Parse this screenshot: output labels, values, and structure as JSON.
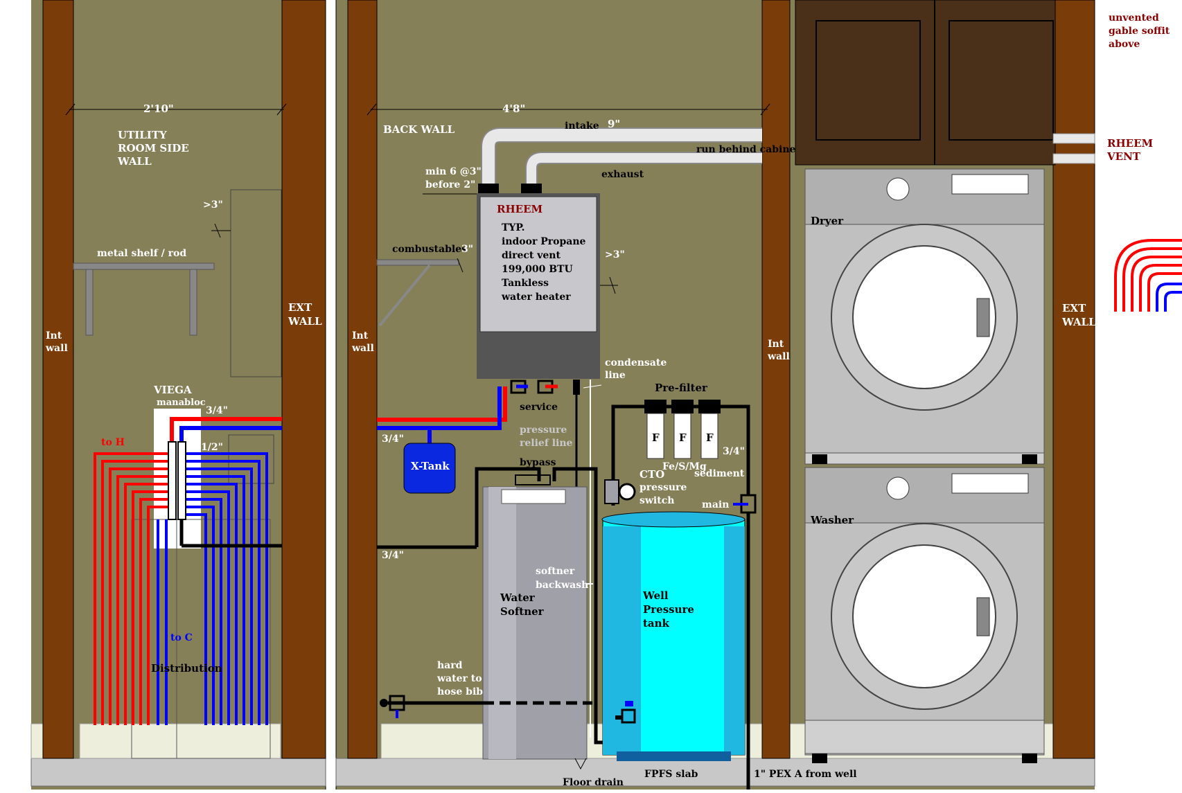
{
  "colors": {
    "wall": "#868059",
    "stud": "#7a3c08",
    "floor": "#c8c8c8",
    "baseboard": "#eeeedd",
    "hot": "#ff0000",
    "cold": "#0000ff",
    "label": "#ffffff",
    "redlabel": "#8b0000",
    "tank_light": "#00ffff",
    "tank_dark": "#20b8e0"
  },
  "left_panel": {
    "dimension": "2'10\"",
    "title": [
      "UTILITY",
      "ROOM SIDE",
      "WALL"
    ],
    "clearance_right": ">3\"",
    "shelf": "metal shelf / rod",
    "int_wall": [
      "Int",
      "wall"
    ],
    "ext_wall": [
      "EXT",
      "WALL"
    ],
    "manifold": [
      "VIEGA",
      "manabloc"
    ],
    "supply_hot": "3/4\"",
    "supply_cold": "1/2\"",
    "to_hot": "to H",
    "to_cold": "to C",
    "distribution": "Distribution"
  },
  "center_panel": {
    "dimension": "4'8\"",
    "back_wall": "BACK WALL",
    "intake": "intake",
    "intake_len": "9\"",
    "exhaust": "exhaust",
    "run_behind": "run behind cabinet",
    "vent_rule": [
      "min 6 @3\"",
      "before 2\""
    ],
    "heater_brand": "RHEEM",
    "heater_text": [
      "TYP.",
      "indoor Propane",
      "direct vent",
      "199,000 BTU",
      "Tankless",
      "water heater"
    ],
    "combustables": "combustables",
    "combustables_clear": "3\"",
    "heater_clear_right": ">3\"",
    "int_wall": [
      "Int",
      "wall"
    ],
    "condensate": [
      "condensate",
      "line"
    ],
    "service": "service",
    "pressure_relief": [
      "pressure",
      "relief line"
    ],
    "supply_top": "3/4\"",
    "supply_bottom": "3/4\"",
    "xtank": "X-Tank",
    "bypass": "bypass",
    "prefilter": "Pre-filter",
    "filter_letter": "F",
    "filter_fe": "Fe/S/Mg",
    "filter_sed": "sediment",
    "filter_size": "3/4\"",
    "cto": "CTO",
    "pressure_switch": [
      "pressure",
      "switch"
    ],
    "main": "main",
    "softener_backwash": [
      "softner",
      "backwash"
    ],
    "softener": [
      "Water",
      "Softner"
    ],
    "pressure_tank": [
      "Well",
      "Pressure",
      "tank"
    ],
    "hard_water": [
      "hard",
      "water to",
      "hose bib"
    ],
    "floor_drain": "Floor drain",
    "slab": "FPFS slab",
    "pex_well": "1\" PEX A from well"
  },
  "right_panel": {
    "int_wall": [
      "Int",
      "wall"
    ],
    "ext_wall": [
      "EXT",
      "WALL"
    ],
    "dryer": "Dryer",
    "washer": "Washer",
    "soffit": [
      "unvented",
      "gable soffit",
      "above"
    ],
    "rheem_vent": [
      "RHEEM",
      "VENT"
    ]
  }
}
